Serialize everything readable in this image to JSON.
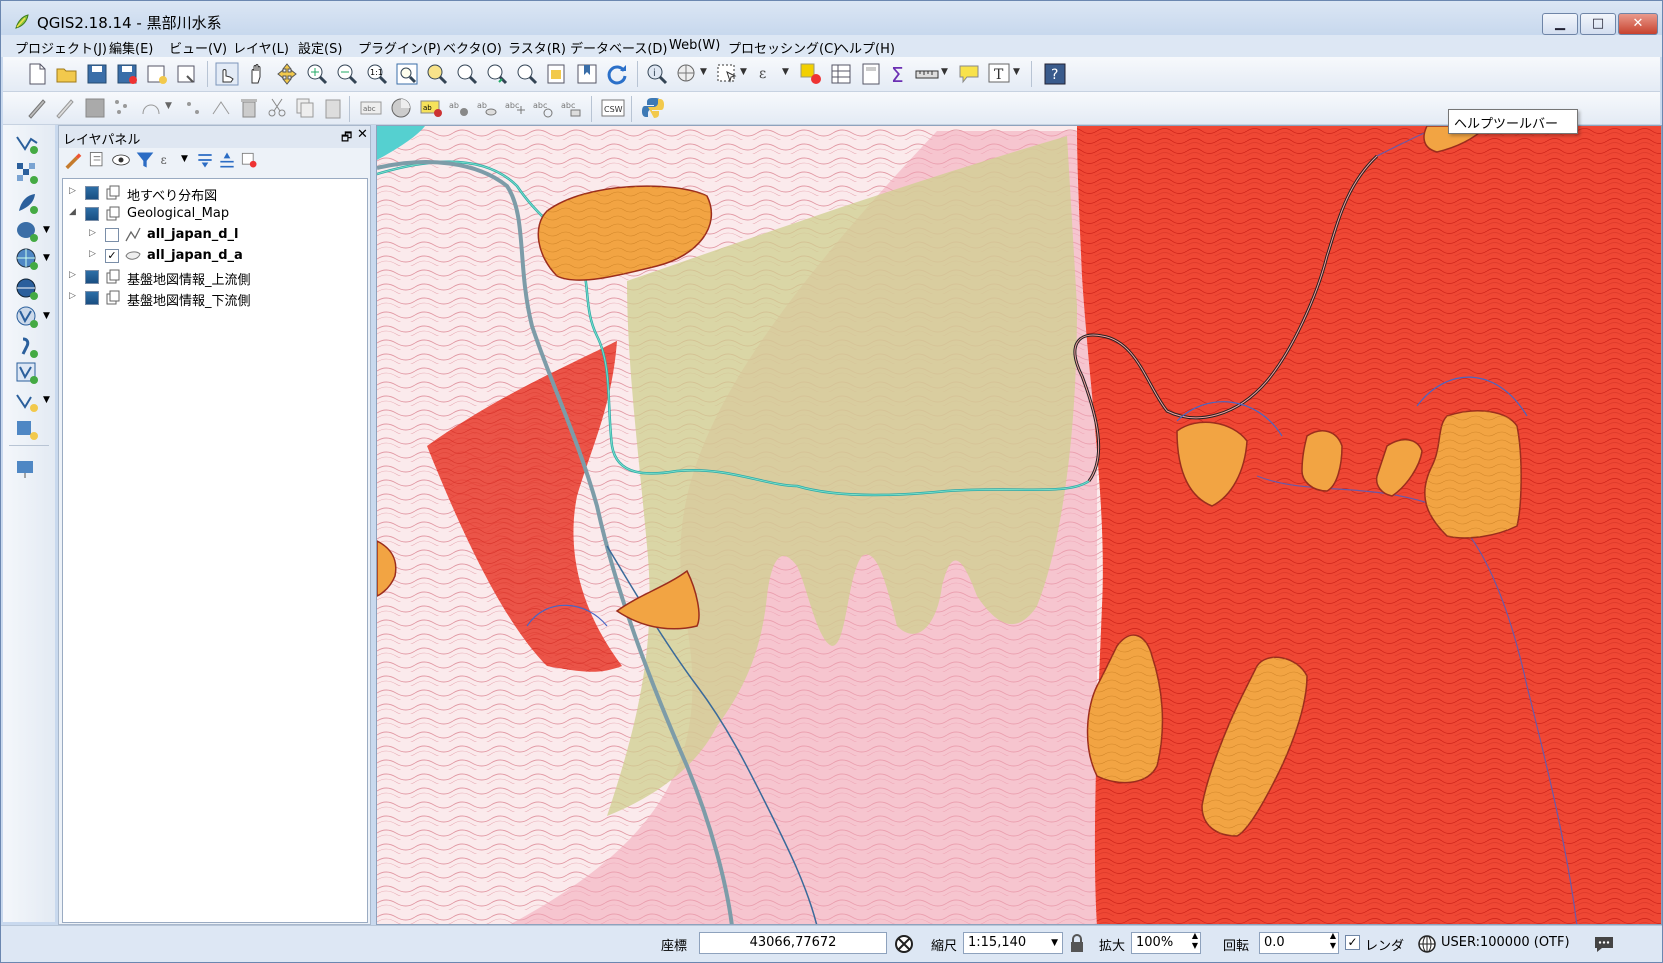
{
  "window": {
    "title": "QGIS2.18.14 - 黒部川水系",
    "buttons": {
      "minimize": "▁",
      "maximize": "□",
      "close": "✕"
    }
  },
  "menubar": {
    "items": [
      "プロジェクト(J)",
      "編集(E)",
      "ビュー(V)",
      "レイヤ(L)",
      "設定(S)",
      "プラグイン(P)",
      "ベクタ(O)",
      "ラスタ(R)",
      "データベース(D)",
      "Web(W)",
      "プロセッシング(C)",
      "ヘルプ(H)"
    ]
  },
  "tooltip": {
    "text": "ヘルプツールバー"
  },
  "layer_panel": {
    "title": "レイヤパネル",
    "layers": [
      {
        "label": "地すべり分布図",
        "expand": "▷",
        "checked": true,
        "bold": false
      },
      {
        "label": "Geological_Map",
        "expand": "◢",
        "checked": true,
        "bold": false
      },
      {
        "label": "all_japan_d_l",
        "expand": "▷",
        "checked": false,
        "bold": true
      },
      {
        "label": "all_japan_d_a",
        "expand": "▷",
        "checked": true,
        "bold": true
      },
      {
        "label": "基盤地図情報_上流側",
        "expand": "▷",
        "checked": true,
        "bold": false
      },
      {
        "label": "基盤地図情報_下流側",
        "expand": "▷",
        "checked": true,
        "bold": false
      }
    ]
  },
  "statusbar": {
    "coord_label": "座標",
    "coord_value": "43066,77672",
    "scale_label": "縮尺",
    "scale_value": "1:15,140",
    "magnifier_label": "拡大",
    "magnifier_value": "100%",
    "rotation_label": "回転",
    "rotation_value": "0.0",
    "render_label": "レンダ",
    "render_checked": true,
    "crs": "USER:100000 (OTF)"
  },
  "colors": {
    "accent": "#2d6ea6",
    "geology_red": "#ee4030",
    "landslide_orange": "#f0a040",
    "geology_olive": "#c8c888",
    "geology_pink": "#f4aab8"
  }
}
